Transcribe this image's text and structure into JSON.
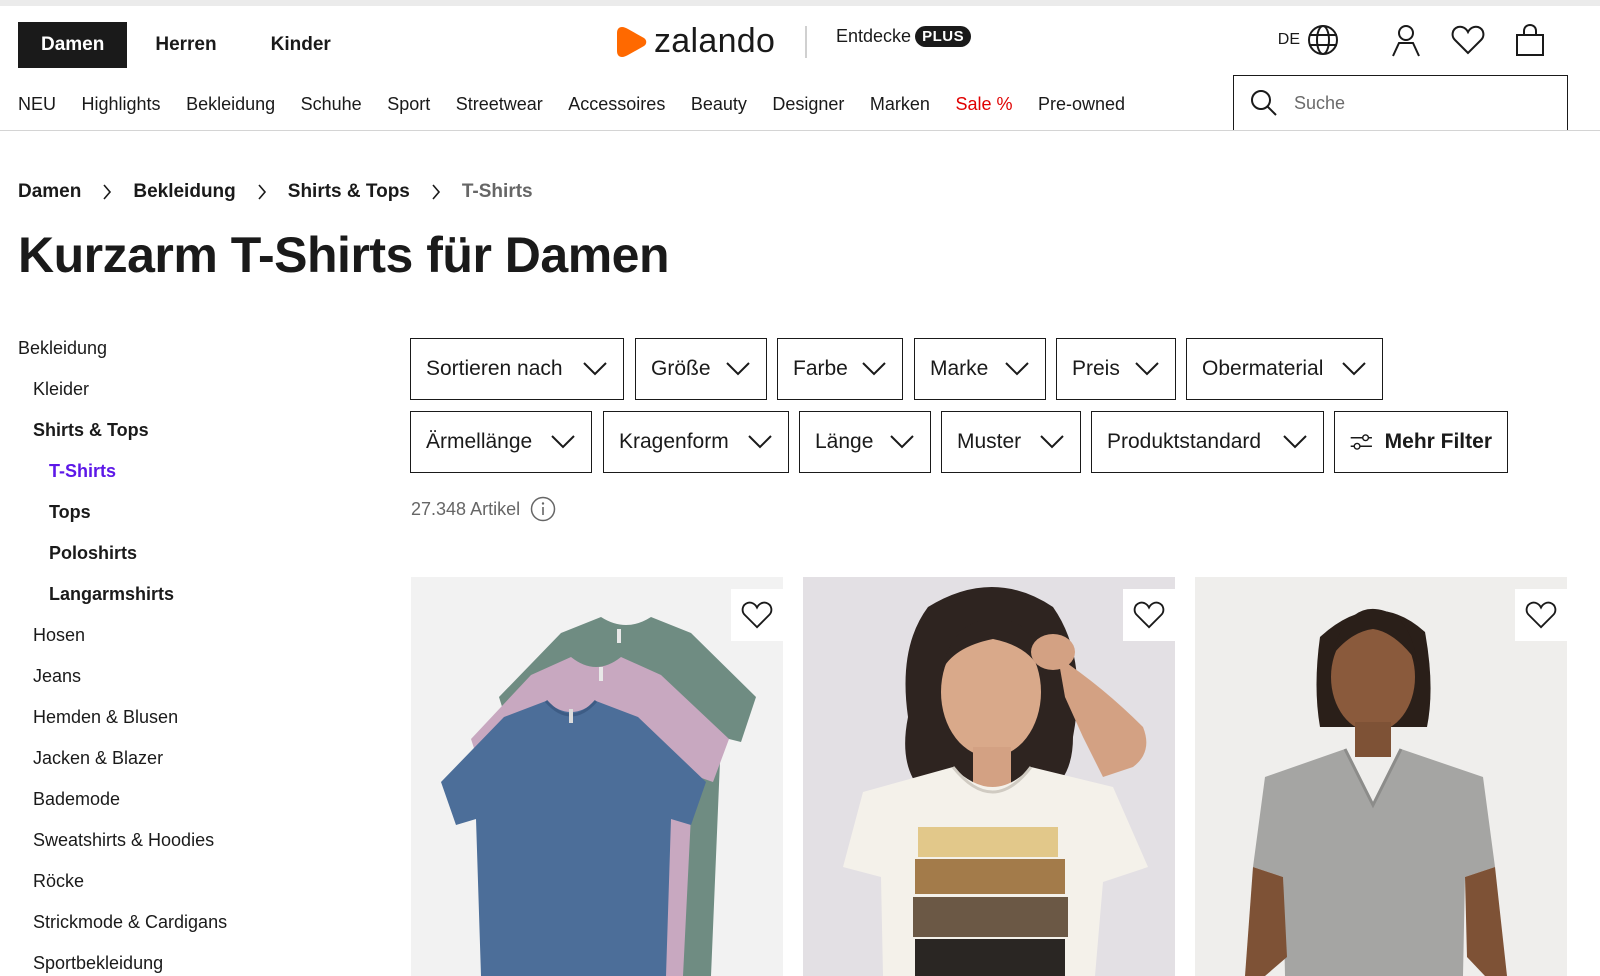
{
  "header": {
    "gender_tabs": [
      {
        "label": "Damen",
        "active": true
      },
      {
        "label": "Herren",
        "active": false
      },
      {
        "label": "Kinder",
        "active": false
      }
    ],
    "logo_text": "zalando",
    "plus_prefix": "Entdecke",
    "plus_badge": "PLUS",
    "language": "DE",
    "icons": [
      "globe-icon",
      "user-icon",
      "heart-icon",
      "bag-icon"
    ],
    "accent_color": "#ff6900"
  },
  "category_nav": [
    {
      "label": "NEU"
    },
    {
      "label": "Highlights"
    },
    {
      "label": "Bekleidung"
    },
    {
      "label": "Schuhe"
    },
    {
      "label": "Sport"
    },
    {
      "label": "Streetwear"
    },
    {
      "label": "Accessoires"
    },
    {
      "label": "Beauty"
    },
    {
      "label": "Designer"
    },
    {
      "label": "Marken"
    },
    {
      "label": "Sale %",
      "color": "#e00000"
    },
    {
      "label": "Pre-owned"
    }
  ],
  "search": {
    "placeholder": "Suche",
    "value": ""
  },
  "breadcrumb": [
    "Damen",
    "Bekleidung",
    "Shirts & Tops",
    "T-Shirts"
  ],
  "page_title": "Kurzarm T-Shirts für Damen",
  "sidebar": {
    "items": [
      {
        "label": "Bekleidung"
      },
      {
        "label": "Kleider"
      },
      {
        "label": "Shirts & Tops"
      },
      {
        "label": "T-Shirts",
        "active": true
      },
      {
        "label": "Tops"
      },
      {
        "label": "Poloshirts"
      },
      {
        "label": "Langarmshirts"
      },
      {
        "label": "Hosen"
      },
      {
        "label": "Jeans"
      },
      {
        "label": "Hemden & Blusen"
      },
      {
        "label": "Jacken & Blazer"
      },
      {
        "label": "Bademode"
      },
      {
        "label": "Sweatshirts & Hoodies"
      },
      {
        "label": "Röcke"
      },
      {
        "label": "Strickmode & Cardigans"
      },
      {
        "label": "Sportbekleidung"
      }
    ],
    "active_color": "#5d18e8"
  },
  "filters": {
    "row1": [
      "Sortieren nach",
      "Größe",
      "Farbe",
      "Marke",
      "Preis",
      "Obermaterial"
    ],
    "row2": [
      "Ärmellänge",
      "Kragenform",
      "Länge",
      "Muster",
      "Produktstandard"
    ],
    "more_label": "Mehr Filter"
  },
  "result_count": "27.348 Artikel",
  "products": [
    {
      "image": "three stacked short-sleeve t-shirts in green, pink and blue",
      "wishlist_icon": "heart-outline-icon"
    },
    {
      "image": "woman with curly hair in white printed t-shirt",
      "wishlist_icon": "heart-outline-icon"
    },
    {
      "image": "woman in grey v-neck t-shirt",
      "wishlist_icon": "heart-outline-icon"
    }
  ]
}
